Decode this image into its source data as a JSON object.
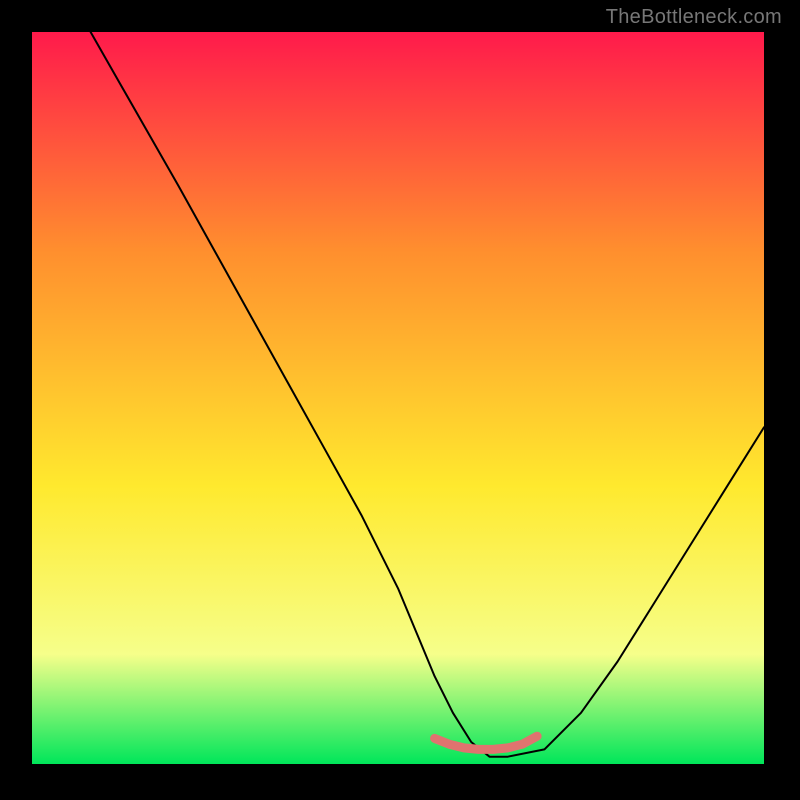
{
  "watermark": "TheBottleneck.com",
  "colors": {
    "gradient_top": "#ff1a4b",
    "gradient_mid1": "#ff8f2e",
    "gradient_mid2": "#ffe92e",
    "gradient_mid3": "#f6ff8a",
    "gradient_bottom": "#00e65a",
    "curve": "#000000",
    "valley_mark": "#e0736f"
  },
  "chart_data": {
    "type": "line",
    "title": "",
    "xlabel": "",
    "ylabel": "",
    "xlim": [
      0,
      100
    ],
    "ylim": [
      0,
      100
    ],
    "series": [
      {
        "name": "bottleneck-curve",
        "x": [
          8,
          12,
          16,
          20,
          25,
          30,
          35,
          40,
          45,
          50,
          52.5,
          55,
          57.5,
          60,
          62.5,
          65,
          70,
          75,
          80,
          85,
          90,
          95,
          100
        ],
        "y": [
          100,
          93,
          86,
          79,
          70,
          61,
          52,
          43,
          34,
          24,
          18,
          12,
          7,
          3,
          1,
          1,
          2,
          7,
          14,
          22,
          30,
          38,
          46
        ]
      },
      {
        "name": "valley-highlight",
        "x": [
          55,
          57,
          59,
          61,
          63,
          65,
          67,
          69
        ],
        "y": [
          3.5,
          2.7,
          2.2,
          2.0,
          2.0,
          2.2,
          2.7,
          3.8
        ]
      }
    ]
  }
}
